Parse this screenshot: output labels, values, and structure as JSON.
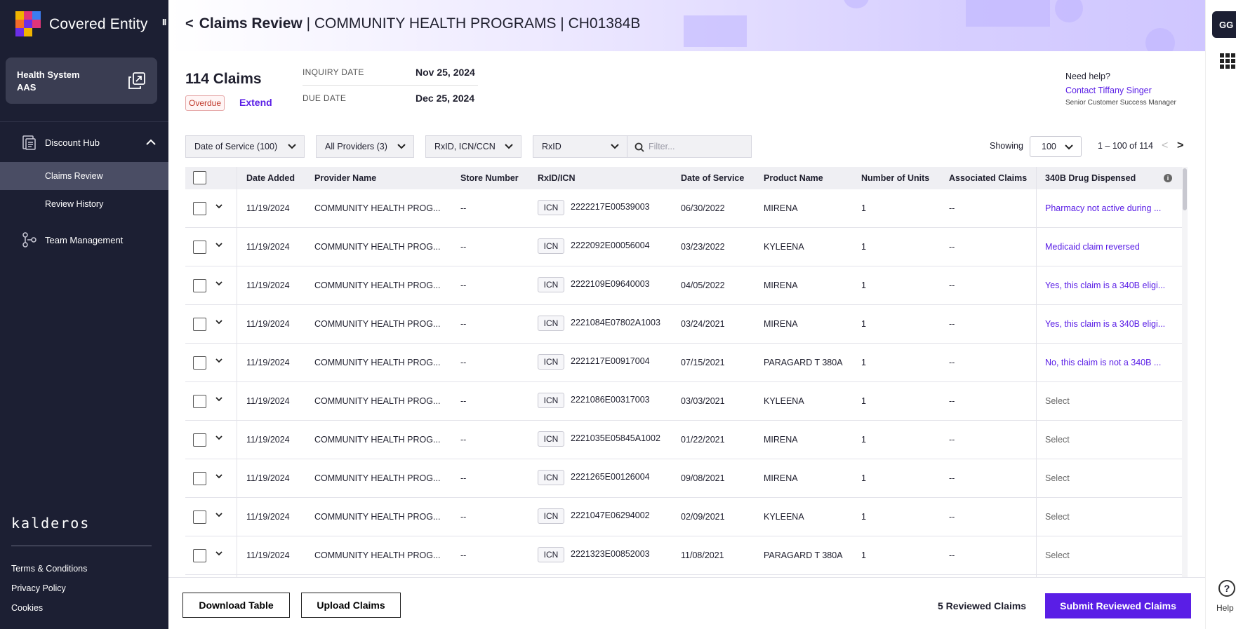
{
  "app": {
    "title": "Covered Entity",
    "collapse_label": "II"
  },
  "org": {
    "line1": "Health System",
    "line2": "AAS"
  },
  "nav": {
    "discount_hub": "Discount Hub",
    "claims_review": "Claims Review",
    "review_history": "Review History",
    "team_management": "Team Management"
  },
  "brand_footer": "kalderos",
  "footer_links": [
    "Terms & Conditions",
    "Privacy Policy",
    "Cookies"
  ],
  "header": {
    "title_bold": "Claims Review",
    "title_rest": " | COMMUNITY HEALTH PROGRAMS | CH01384B"
  },
  "user": {
    "initials": "GG"
  },
  "rail": {
    "help_label": "Help"
  },
  "summary": {
    "count": "114 Claims",
    "status_badge": "Overdue",
    "extend_label": "Extend",
    "inquiry_label": "INQUIRY DATE",
    "inquiry_value": "Nov 25, 2024",
    "due_label": "DUE DATE",
    "due_value": "Dec 25, 2024"
  },
  "help": {
    "question": "Need help?",
    "contact": "Contact Tiffany Singer",
    "role": "Senior Customer Success Manager"
  },
  "filters": {
    "date_of_service": "Date of Service (100)",
    "providers": "All Providers (3)",
    "id_type": "RxID, ICN/CCN",
    "search_field": "RxID",
    "search_placeholder": "Filter..."
  },
  "pagination": {
    "showing_label": "Showing",
    "page_size": "100",
    "range": "1 – 100 of 114"
  },
  "table": {
    "headers": [
      "Date Added",
      "Provider Name",
      "Store Number",
      "RxID/ICN",
      "Date of Service",
      "Product Name",
      "Number of Units",
      "Associated Claims",
      "340B Drug Dispensed"
    ],
    "rows": [
      {
        "date_added": "11/19/2024",
        "provider": "COMMUNITY HEALTH PROG...",
        "store": "--",
        "badge": "ICN",
        "id": "2222217E00539003",
        "dos": "06/30/2022",
        "product": "MIRENA",
        "units": "1",
        "assoc": "--",
        "dispensed": "Pharmacy not active during ...",
        "state": "purple"
      },
      {
        "date_added": "11/19/2024",
        "provider": "COMMUNITY HEALTH PROG...",
        "store": "--",
        "badge": "ICN",
        "id": "2222092E00056004",
        "dos": "03/23/2022",
        "product": "KYLEENA",
        "units": "1",
        "assoc": "--",
        "dispensed": "Medicaid claim reversed",
        "state": "purple"
      },
      {
        "date_added": "11/19/2024",
        "provider": "COMMUNITY HEALTH PROG...",
        "store": "--",
        "badge": "ICN",
        "id": "2222109E09640003",
        "dos": "04/05/2022",
        "product": "MIRENA",
        "units": "1",
        "assoc": "--",
        "dispensed": "Yes, this claim is a 340B eligi...",
        "state": "purple"
      },
      {
        "date_added": "11/19/2024",
        "provider": "COMMUNITY HEALTH PROG...",
        "store": "--",
        "badge": "ICN",
        "id": "2221084E07802A1003",
        "dos": "03/24/2021",
        "product": "MIRENA",
        "units": "1",
        "assoc": "--",
        "dispensed": "Yes, this claim is a 340B eligi...",
        "state": "purple"
      },
      {
        "date_added": "11/19/2024",
        "provider": "COMMUNITY HEALTH PROG...",
        "store": "--",
        "badge": "ICN",
        "id": "2221217E00917004",
        "dos": "07/15/2021",
        "product": "PARAGARD T 380A",
        "units": "1",
        "assoc": "--",
        "dispensed": "No, this claim is not a 340B ...",
        "state": "purple"
      },
      {
        "date_added": "11/19/2024",
        "provider": "COMMUNITY HEALTH PROG...",
        "store": "--",
        "badge": "ICN",
        "id": "2221086E00317003",
        "dos": "03/03/2021",
        "product": "KYLEENA",
        "units": "1",
        "assoc": "--",
        "dispensed": "Select",
        "state": "grey"
      },
      {
        "date_added": "11/19/2024",
        "provider": "COMMUNITY HEALTH PROG...",
        "store": "--",
        "badge": "ICN",
        "id": "2221035E05845A1002",
        "dos": "01/22/2021",
        "product": "MIRENA",
        "units": "1",
        "assoc": "--",
        "dispensed": "Select",
        "state": "grey"
      },
      {
        "date_added": "11/19/2024",
        "provider": "COMMUNITY HEALTH PROG...",
        "store": "--",
        "badge": "ICN",
        "id": "2221265E00126004",
        "dos": "09/08/2021",
        "product": "MIRENA",
        "units": "1",
        "assoc": "--",
        "dispensed": "Select",
        "state": "grey"
      },
      {
        "date_added": "11/19/2024",
        "provider": "COMMUNITY HEALTH PROG...",
        "store": "--",
        "badge": "ICN",
        "id": "2221047E06294002",
        "dos": "02/09/2021",
        "product": "KYLEENA",
        "units": "1",
        "assoc": "--",
        "dispensed": "Select",
        "state": "grey"
      },
      {
        "date_added": "11/19/2024",
        "provider": "COMMUNITY HEALTH PROG...",
        "store": "--",
        "badge": "ICN",
        "id": "2221323E00852003",
        "dos": "11/08/2021",
        "product": "PARAGARD T 380A",
        "units": "1",
        "assoc": "--",
        "dispensed": "Select",
        "state": "grey"
      }
    ]
  },
  "actions": {
    "download": "Download Table",
    "upload": "Upload Claims",
    "reviewed": "5 Reviewed Claims",
    "submit": "Submit Reviewed Claims"
  },
  "colors": {
    "sidebar": "#1c1f33",
    "accent": "#5a1ee6",
    "overdue": "#c0392b"
  }
}
